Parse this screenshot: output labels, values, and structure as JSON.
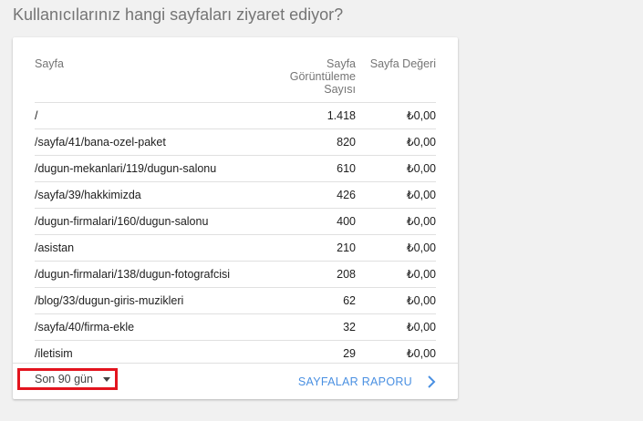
{
  "heading": "Kullanıcılarınız hangi sayfaları ziyaret ediyor?",
  "table": {
    "columns": {
      "page": "Sayfa",
      "views_line1": "Sayfa",
      "views_line2": "Görüntüleme",
      "views_line3": "Sayısı",
      "value": "Sayfa Değeri"
    },
    "rows": [
      {
        "page": "/",
        "views": "1.418",
        "value": "₺0,00"
      },
      {
        "page": "/sayfa/41/bana-ozel-paket",
        "views": "820",
        "value": "₺0,00"
      },
      {
        "page": "/dugun-mekanlari/119/dugun-salonu",
        "views": "610",
        "value": "₺0,00"
      },
      {
        "page": "/sayfa/39/hakkimizda",
        "views": "426",
        "value": "₺0,00"
      },
      {
        "page": "/dugun-firmalari/160/dugun-salonu",
        "views": "400",
        "value": "₺0,00"
      },
      {
        "page": "/asistan",
        "views": "210",
        "value": "₺0,00"
      },
      {
        "page": "/dugun-firmalari/138/dugun-fotografcisi",
        "views": "208",
        "value": "₺0,00"
      },
      {
        "page": "/blog/33/dugun-giris-muzikleri",
        "views": "62",
        "value": "₺0,00"
      },
      {
        "page": "/sayfa/40/firma-ekle",
        "views": "32",
        "value": "₺0,00"
      },
      {
        "page": "/iletisim",
        "views": "29",
        "value": "₺0,00"
      }
    ]
  },
  "footer": {
    "date_range": "Son 90 gün",
    "report_link": "SAYFALAR RAPORU",
    "icons": {
      "dropdown": "caret-down-icon",
      "link": "chevron-right-icon"
    },
    "colors": {
      "link": "#4a90e2",
      "highlight": "#e3141e"
    }
  }
}
